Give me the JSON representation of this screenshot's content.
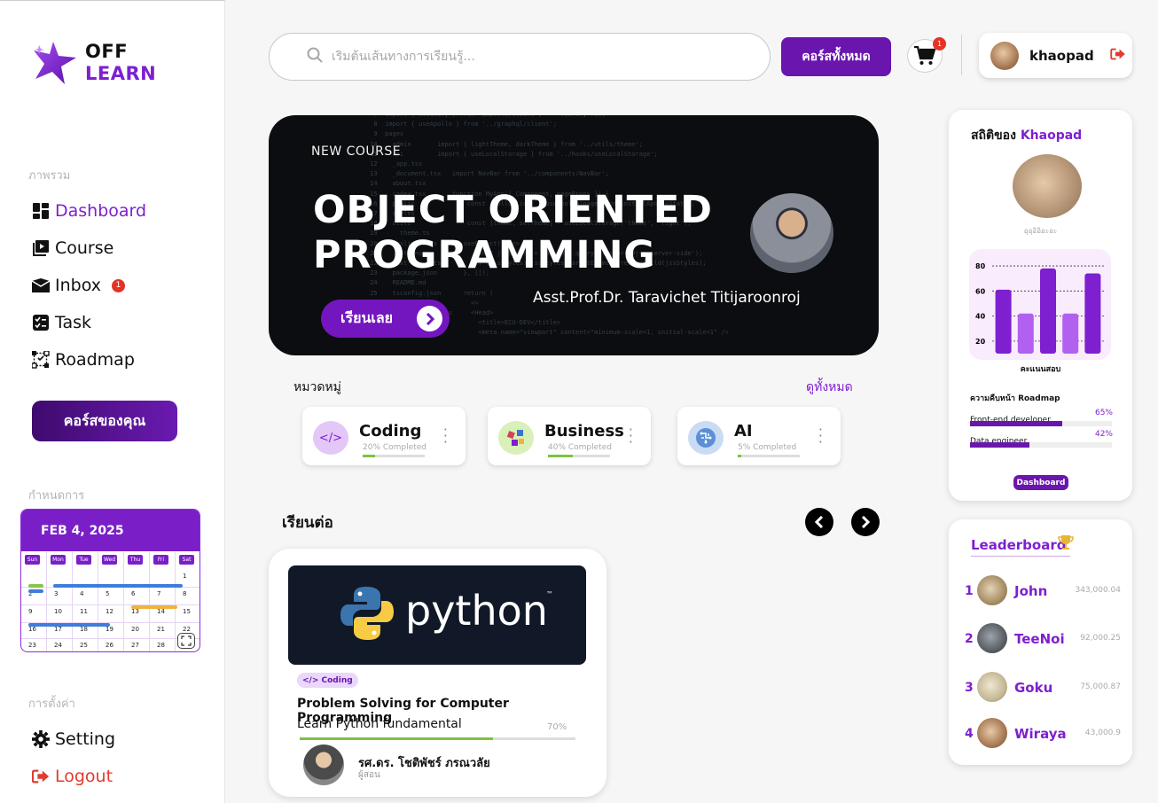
{
  "brand": {
    "line1": "OFF",
    "line2": "LEARN"
  },
  "sidebar": {
    "overview_label": "ภาพรวม",
    "nav": [
      {
        "label": "Dashboard",
        "icon": "dashboard-icon"
      },
      {
        "label": "Course",
        "icon": "course-icon"
      },
      {
        "label": "Inbox",
        "icon": "inbox-icon",
        "badge": "1"
      },
      {
        "label": "Task",
        "icon": "task-icon"
      },
      {
        "label": "Roadmap",
        "icon": "roadmap-icon"
      }
    ],
    "my_courses_button": "คอร์สของคุณ",
    "schedule_label": "กำหนดการ",
    "settings_label": "การตั้งค่า",
    "setting": "Setting",
    "logout": "Logout"
  },
  "calendar": {
    "date": "FEB 4, 2025",
    "weekdays": [
      "Sun",
      "Mon",
      "Tue",
      "Wed",
      "Thu",
      "Fri",
      "Sat"
    ],
    "weeks": [
      [
        "",
        "",
        "",
        "",
        "",
        "",
        "1"
      ],
      [
        "2",
        "3",
        "4",
        "5",
        "6",
        "7",
        "8"
      ],
      [
        "9",
        "10",
        "11",
        "12",
        "13",
        "14",
        "15"
      ],
      [
        "16",
        "17",
        "18",
        "19",
        "20",
        "21",
        "22"
      ],
      [
        "23",
        "24",
        "25",
        "26",
        "27",
        "28",
        ""
      ]
    ],
    "event_colors": [
      "#3f7ddb",
      "#8bc34a",
      "#f0b43c"
    ]
  },
  "topbar": {
    "search_placeholder": "เริ่มต้นเส้นทางการเรียนรู้...",
    "all_courses_button": "คอร์สทั้งหมด",
    "cart_count": "1",
    "username": "khaopad"
  },
  "hero": {
    "tag": "NEW COURSE",
    "title_line1": "OBJECT ORIENTED",
    "title_line2": "PROGRAMMING",
    "instructor": "Asst.Prof.Dr. Taravichet Titijaroonroj",
    "button": "เรียนเลย"
  },
  "categories": {
    "label": "หมวดหมู่",
    "see_all": "ดูทั้งหมด",
    "items": [
      {
        "name": "Coding",
        "completed": "20% Completed",
        "progress": 0.2,
        "icon_bg": "#e3c8f7"
      },
      {
        "name": "Business",
        "completed": "40% Completed",
        "progress": 0.4,
        "icon_bg": "#d9f0b8"
      },
      {
        "name": "AI",
        "completed": "5% Completed",
        "progress": 0.05,
        "icon_bg": "#c9dcf3"
      }
    ]
  },
  "continue": {
    "label": "เรียนต่อ",
    "course": {
      "thumb_text": "python",
      "thumb_tm": "™",
      "tag": "</> Coding",
      "title": "Problem Solving for Computer Programming",
      "subtitle": "Learn Python fundamental",
      "percent_text": "70%",
      "progress": 0.7,
      "teacher": "รศ.ดร. โชติพัชร์ ภรณวลัย",
      "teacher_role": "ผู้สอน"
    }
  },
  "stats": {
    "title_prefix": "สถิติของ",
    "title_name": "Khaopad",
    "caption": "อุอุอิอิอะอะ",
    "chart_label": "คะแนนสอบ",
    "roadmap_title": "ความคืบหน้า Roadmap",
    "roadmap": [
      {
        "label": "Front-end developer",
        "percent_text": "65%",
        "progress": 0.65
      },
      {
        "label": "Data engineer",
        "percent_text": "42%",
        "progress": 0.42
      }
    ],
    "dashboard_button": "Dashboard"
  },
  "chart_data": {
    "type": "bar",
    "title": "",
    "xlabel": "คะแนนสอบ",
    "ylabel": "",
    "categories": [
      "1",
      "2",
      "3",
      "4",
      "5"
    ],
    "values": [
      61,
      42,
      78,
      42,
      74
    ],
    "ylim": [
      10,
      85
    ],
    "yticks": [
      "20",
      "40",
      "60",
      "80"
    ],
    "grid": true,
    "colors": [
      "#7e1fd0",
      "#b160ef",
      "#7e1fd0",
      "#b160ef",
      "#7e1fd0"
    ]
  },
  "leaderboard": {
    "title": "Leaderboard",
    "rows": [
      {
        "rank": "1",
        "name": "John",
        "score": "343,000.04"
      },
      {
        "rank": "2",
        "name": "TeeNoi",
        "score": "92,000.25"
      },
      {
        "rank": "3",
        "name": "Goku",
        "score": "75,000.87"
      },
      {
        "rank": "4",
        "name": "Wiraya",
        "score": "43,000.9"
      }
    ]
  }
}
